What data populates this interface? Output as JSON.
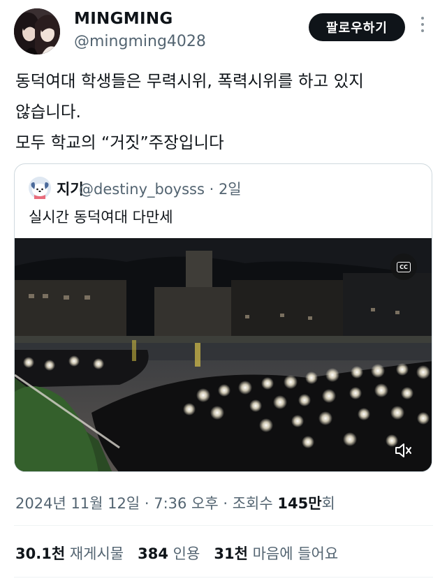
{
  "author": {
    "display_name": "MINGMING",
    "handle": "@mingming4028",
    "avatar_icon": "profile-photo-two-people"
  },
  "follow_label": "팔로우하기",
  "more_icon": "vertical-ellipsis-icon",
  "tweet": {
    "lines": [
      "동덕여대 학생들은 무력시위, 폭력시위를 하고 있지",
      "않습니다.",
      "모두 학교의 “거짓”주장입니다"
    ]
  },
  "quote": {
    "display_name": "지기",
    "handle_meta": "@destiny_boysss · 2일",
    "text": "실시간 동덕여대 다만세",
    "avatar_icon": "pochacco-dog-avatar",
    "media": {
      "description_icon": "night-video-crowd",
      "cc_label": "CC",
      "mute_icon": "speaker-muted-icon"
    }
  },
  "meta": {
    "prefix": "2024년 11월 12일 · 7:36 오후 · 조회수 ",
    "views_bold": "145만",
    "views_suffix": "회"
  },
  "stats": [
    {
      "num": "30.1천",
      "label": "재게시물"
    },
    {
      "num": "384",
      "label": "인용"
    },
    {
      "num": "31천",
      "label": "마음에 들어요"
    }
  ],
  "colors": {
    "text": "#0f1419",
    "secondary": "#536471",
    "follow_bg": "#0f1419",
    "border": "#cfd9de"
  }
}
